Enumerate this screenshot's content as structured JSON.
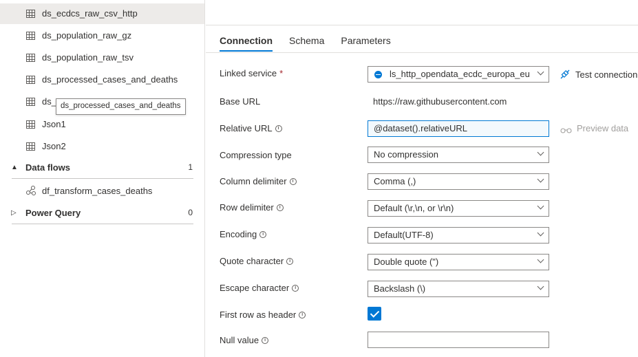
{
  "tree": {
    "datasets": [
      {
        "label": "ds_ecdcs_raw_csv_http",
        "icon": "table-icon",
        "selected": true
      },
      {
        "label": "ds_population_raw_gz",
        "icon": "table-icon"
      },
      {
        "label": "ds_population_raw_tsv",
        "icon": "table-icon"
      },
      {
        "label": "ds_processed_cases_and_deaths",
        "icon": "table-icon"
      },
      {
        "label": "ds_",
        "icon": "table-icon"
      },
      {
        "label": "Json1",
        "icon": "table-icon"
      },
      {
        "label": "Json2",
        "icon": "table-icon"
      }
    ],
    "tooltip": "ds_processed_cases_and_deaths",
    "data_flows": {
      "label": "Data flows",
      "count": "1",
      "caret": "▲"
    },
    "data_flow_items": [
      {
        "label": "df_transform_cases_deaths",
        "icon": "dataflow-icon"
      }
    ],
    "power_query": {
      "label": "Power Query",
      "count": "0",
      "caret": "▷"
    }
  },
  "tabs": [
    "Connection",
    "Schema",
    "Parameters"
  ],
  "active_tab": "Connection",
  "form": {
    "linked_service": {
      "label": "Linked service",
      "required": "*",
      "value": "ls_http_opendata_ecdc_europa_eu"
    },
    "test_connection": "Test connection",
    "base_url": {
      "label": "Base URL",
      "value": "https://raw.githubusercontent.com"
    },
    "relative_url": {
      "label": "Relative URL",
      "value": "@dataset().relativeURL"
    },
    "preview_data": "Preview data",
    "compression_type": {
      "label": "Compression type",
      "value": "No compression"
    },
    "column_delimiter": {
      "label": "Column delimiter",
      "value": "Comma (,)"
    },
    "row_delimiter": {
      "label": "Row delimiter",
      "value": "Default (\\r,\\n, or \\r\\n)"
    },
    "encoding": {
      "label": "Encoding",
      "value": "Default(UTF-8)"
    },
    "quote_character": {
      "label": "Quote character",
      "value": "Double quote (\")"
    },
    "escape_character": {
      "label": "Escape character",
      "value": "Backslash (\\)"
    },
    "first_row_header": {
      "label": "First row as header",
      "checked": true
    },
    "null_value": {
      "label": "Null value",
      "value": ""
    }
  },
  "colors": {
    "accent": "#0078d4",
    "selected_row": "#edebe9",
    "required": "#a4262c"
  }
}
